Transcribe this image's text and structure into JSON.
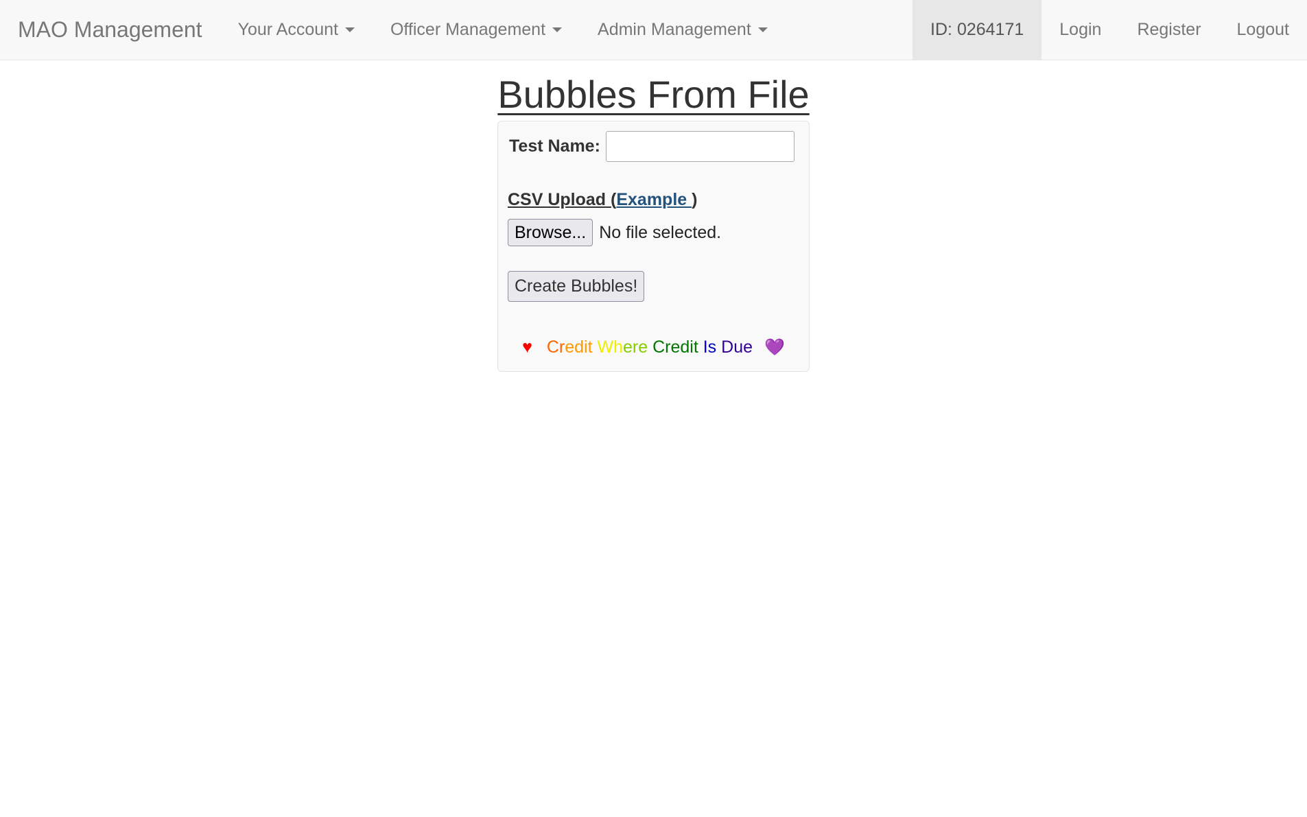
{
  "navbar": {
    "brand": "MAO Management",
    "menus": [
      {
        "label": "Your Account"
      },
      {
        "label": "Officer Management"
      },
      {
        "label": "Admin Management"
      }
    ],
    "user_id": "ID: 0264171",
    "login": "Login",
    "register": "Register",
    "logout": "Logout"
  },
  "page": {
    "title": "Bubbles From File"
  },
  "form": {
    "test_name_label": "Test Name:",
    "test_name_value": "",
    "csv_label_prefix": "CSV Upload (",
    "csv_example_link": "Example ",
    "csv_label_suffix": ")",
    "browse_button": "Browse...",
    "file_status": "No file selected.",
    "submit_button": "Create Bubbles!"
  },
  "credit": {
    "heart": "♥",
    "parts": [
      {
        "text": "Cr",
        "color": "#ff6600"
      },
      {
        "text": "edit ",
        "color": "#ff9900"
      },
      {
        "text": "Wh",
        "color": "#eeee00"
      },
      {
        "text": "ere ",
        "color": "#88cc00"
      },
      {
        "text": "Credit ",
        "color": "#007700"
      },
      {
        "text": "Is ",
        "color": "#0000cc"
      },
      {
        "text": "Due",
        "color": "#330099"
      }
    ],
    "end_heart": "💜",
    "heart_color": "#ff0000",
    "end_heart_color": "#aa44cc"
  }
}
